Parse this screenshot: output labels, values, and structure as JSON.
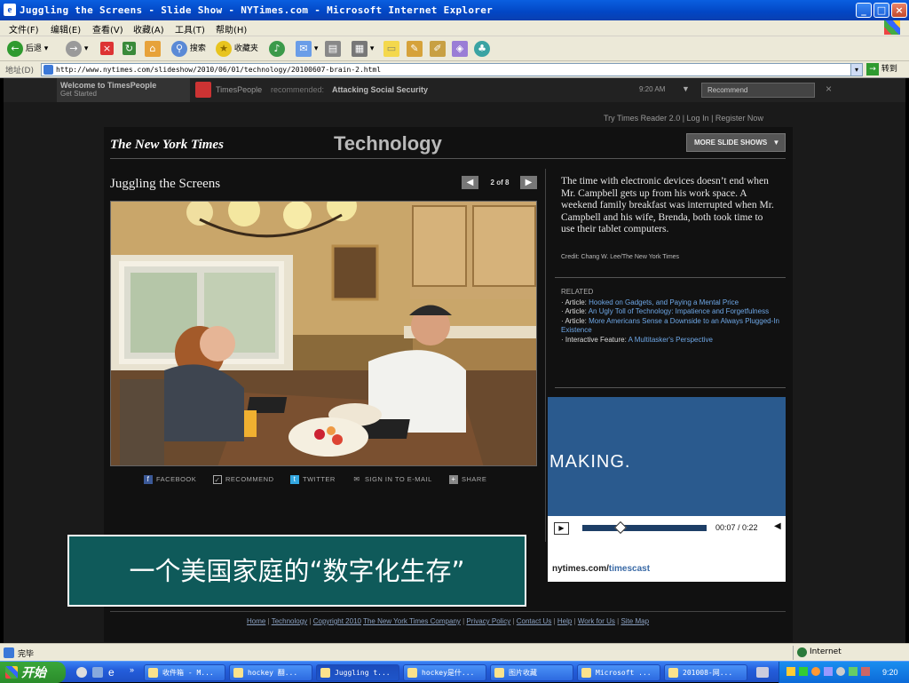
{
  "window": {
    "title": "Juggling the Screens - Slide Show - NYTimes.com - Microsoft Internet Explorer"
  },
  "menu": [
    "文件(F)",
    "编辑(E)",
    "查看(V)",
    "收藏(A)",
    "工具(T)",
    "帮助(H)"
  ],
  "toolbar": {
    "back": "后退",
    "search": "搜索",
    "favorites": "收藏夹"
  },
  "address": {
    "label": "地址(D)",
    "url": "http://www.nytimes.com/slideshow/2010/06/01/technology/20100607-brain-2.html",
    "go": "转到"
  },
  "timespeople": {
    "welcome": "Welcome to TimesPeople",
    "get_started": "Get Started",
    "brand": "TimesPeople",
    "recommended": "recommended:",
    "article": "Attacking Social Security",
    "time": "9:20 AM",
    "recommend_btn": "Recommend",
    "close": "×"
  },
  "top_links": {
    "reader": "Try Times Reader 2.0",
    "login": "Log In",
    "register": "Register Now"
  },
  "header": {
    "logo": "The New York Times",
    "section": "Technology",
    "more_shows": "MORE SLIDE SHOWS"
  },
  "slide": {
    "title": "Juggling the Screens",
    "counter": "2 of 8",
    "caption": "The time with electronic devices doesn’t end when Mr. Campbell gets up from his work space. A weekend family breakfast was interrupted when Mr. Campbell and his wife, Brenda, both took time to use their tablet computers.",
    "credit": "Credit: Chang W. Lee/The New York Times"
  },
  "share": {
    "facebook": "FACEBOOK",
    "recommend": "RECOMMEND",
    "twitter": "TWITTER",
    "email": "SIGN IN TO E-MAIL",
    "share": "SHARE"
  },
  "related": {
    "heading": "RELATED",
    "items": [
      {
        "type": "Article:",
        "text": "Hooked on Gadgets, and Paying a Mental Price"
      },
      {
        "type": "Article:",
        "text": "An Ugly Toll of Technology: Impatience and Forgetfulness"
      },
      {
        "type": "Article:",
        "text": "More Americans Sense a Downside to an Always Plugged-In Existence"
      },
      {
        "type": "Interactive Feature:",
        "text": "A Multitasker's Perspective"
      }
    ]
  },
  "video": {
    "banner_text": "MAKING.",
    "time": "00:07 / 0:22",
    "progress": 0.31,
    "brand": "nytimes.com/",
    "brand2": "timescast"
  },
  "overlay": {
    "text": "一个美国家庭的“数字化生存”"
  },
  "footer": [
    "Home",
    "Technology",
    "Copyright 2010",
    "The New York Times Company",
    "Privacy Policy",
    "Contact Us",
    "Help",
    "Work for Us",
    "Site Map"
  ],
  "status": {
    "done": "完毕",
    "zone": "Internet"
  },
  "taskbar": {
    "start": "开始",
    "buttons": [
      "收件箱 - M...",
      "hockey 翻...",
      "Juggling t...",
      "hockey是什...",
      "图片收藏",
      "Microsoft ...",
      "201008-网..."
    ],
    "clock": "9:20"
  },
  "colors": {
    "accent_blue": "#6ea7e6",
    "overlay_bg": "#0f5a5a",
    "video_blue": "#2a5a8e"
  }
}
